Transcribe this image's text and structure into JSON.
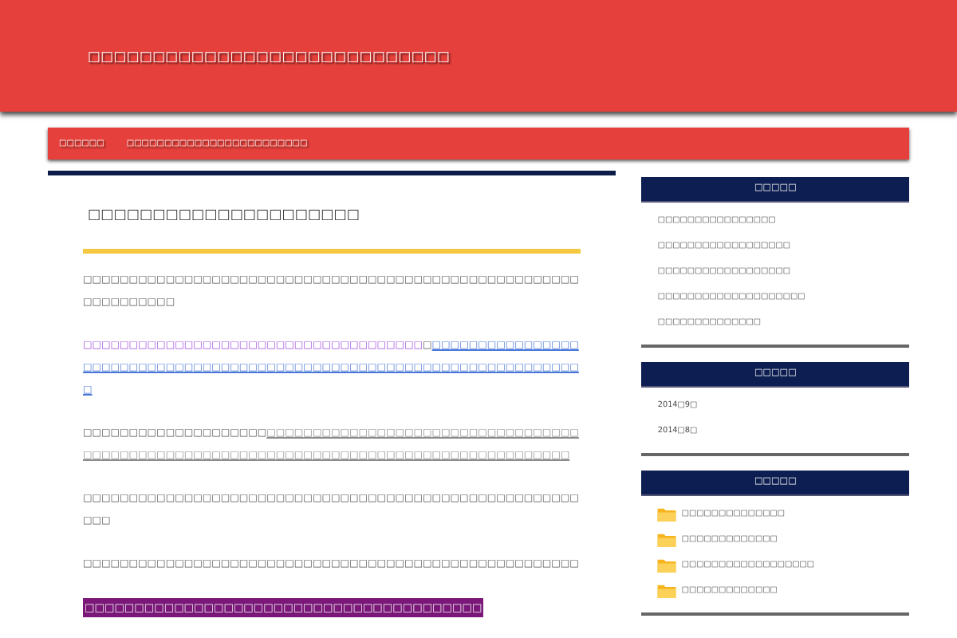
{
  "site_title": "□□□□□□□□□□□□□□□□□□□□□□□□□□□□",
  "nav": [
    {
      "label": "□□□□□□"
    },
    {
      "label": "□□□□□□□□□□□□□□□□□□□□□□□□"
    }
  ],
  "article": {
    "title": "□□□□□□□□□□□□□□□□□□□□□",
    "paragraphs": [
      {
        "kind": "text",
        "parts": [
          {
            "kind": "plain",
            "text": "□□□□□□□□□□□□□□□□□□□□□□□□□□□□□□□□□□□□□□□□□□□□□□□□□□□□□□□□□□□□□□□□"
          }
        ]
      },
      {
        "kind": "text",
        "parts": [
          {
            "kind": "visited",
            "text": "□□□□□□□□□□□□□□□□□□□□□□□□□□□□□□□□□□□□□"
          },
          {
            "kind": "plain",
            "text": "□"
          },
          {
            "kind": "link",
            "text": "□□□□□□□□□□□□□□□□□□□□□□□□□□□□□□□□□□□□□□□□□□□□□□□□□□□□□□□□□□□□□□□□□□□□□□□"
          }
        ]
      },
      {
        "kind": "text",
        "parts": [
          {
            "kind": "plain",
            "text": "□□□□□□□□□□□□□□□□□□□□"
          },
          {
            "kind": "grey-link",
            "text": "□□□□□□□□□□□□□□□□□□□□□□□□□□□□□□□□□□□□□□□□□□□□□□□□□□□□□□□□□□□□□□□□□□□□□□□□□□□□□□□□□□□□□□□"
          }
        ]
      },
      {
        "kind": "text",
        "parts": [
          {
            "kind": "plain",
            "text": "□□□□□□□□□□□□□□□□□□□□□□□□□□□□□□□□□□□□□□□□□□□□□□□□□□□□□□□□□"
          }
        ]
      },
      {
        "kind": "text",
        "parts": [
          {
            "kind": "plain",
            "text": "□□□□□□□□□□□□□□□□□□□□□□□□□□□□□□□□□□□□□□□□□□□□□□□□□□□□□□"
          }
        ]
      },
      {
        "kind": "highlight",
        "parts": [
          {
            "kind": "plain",
            "text": "□□□□□□□□□□□□□□□□□□□□□□□□□□□□□□□□□□□□□□□□"
          }
        ]
      }
    ]
  },
  "sidebar": [
    {
      "heading": "□□□□□",
      "kind": "list",
      "items": [
        "□□□□□□□□□□□□□□□□",
        "□□□□□□□□□□□□□□□□□□",
        "□□□□□□□□□□□□□□□□□□",
        "□□□□□□□□□□□□□□□□□□□□",
        "□□□□□□□□□□□□□□"
      ]
    },
    {
      "heading": "□□□□□",
      "kind": "list",
      "items": [
        "2014□9□",
        "2014□8□"
      ]
    },
    {
      "heading": "□□□□□",
      "kind": "folders",
      "items": [
        "□□□□□□□□□□□□□□",
        "□□□□□□□□□□□□□",
        "□□□□□□□□□□□□□□□□□□",
        "□□□□□□□□□□□□□"
      ]
    }
  ]
}
